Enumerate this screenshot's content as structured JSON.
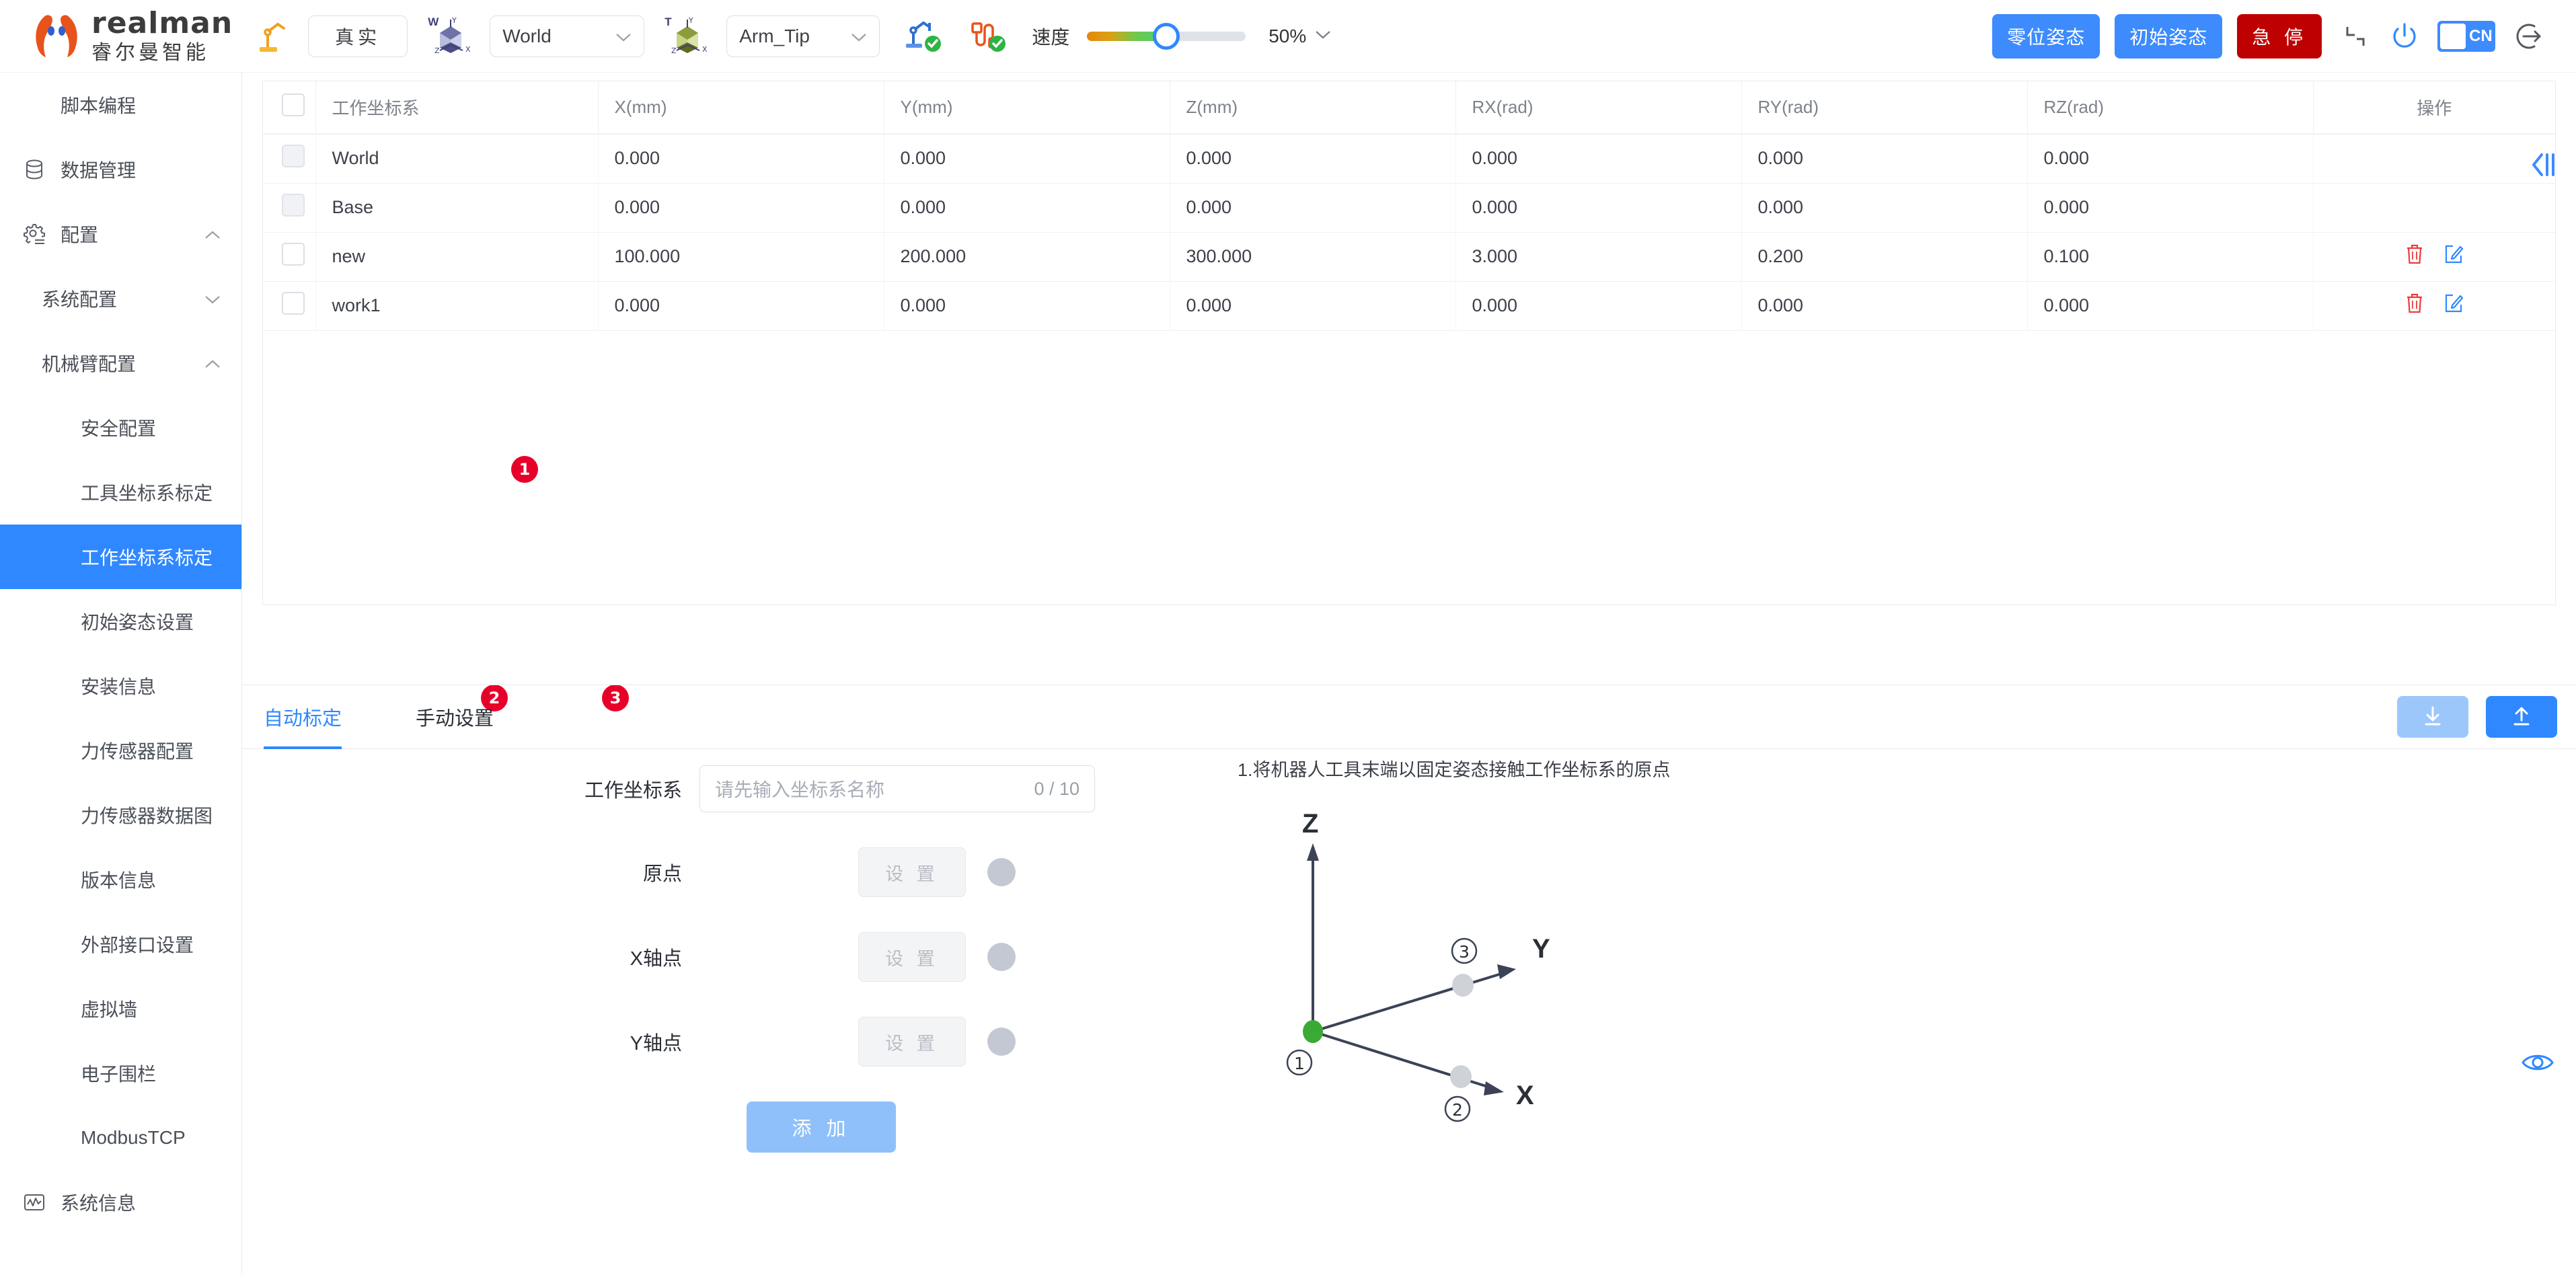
{
  "header": {
    "brand_en": "realman",
    "brand_cn": "睿尔曼智能",
    "robot_icon": "robot-arm-icon",
    "mode_select": {
      "value": "真实",
      "icon": "chevron-down-icon"
    },
    "world_frame_select": {
      "value": "World",
      "badge": "W",
      "icon": "chevron-down-icon"
    },
    "tool_frame_select": {
      "value": "Arm_Tip",
      "badge": "T",
      "icon": "chevron-down-icon"
    },
    "status_arm_icon": "robot-arm-connected-icon",
    "status_cable_icon": "cable-connected-icon",
    "speed_label": "速度",
    "speed_percent": 50,
    "zoom_value": "50%",
    "buttons": {
      "zero_pose": "零位姿态",
      "init_pose": "初始姿态",
      "emergency_stop": "急 停"
    },
    "icons": {
      "minimize": "minimize-icon",
      "power": "power-icon",
      "language": "CN",
      "logout": "logout-icon"
    },
    "colors": {
      "accent": "#3d8bfd",
      "danger": "#bf0000",
      "brand": "#e8531a"
    }
  },
  "sidebar": {
    "items": [
      {
        "label": "脚本编程",
        "icon": "code-icon",
        "level": 0,
        "arrow": "",
        "active": false
      },
      {
        "label": "数据管理",
        "icon": "database-icon",
        "level": 0,
        "arrow": "",
        "active": false
      },
      {
        "label": "配置",
        "icon": "gear-icon",
        "level": 0,
        "arrow": "chevron-up-icon",
        "active": false
      },
      {
        "label": "系统配置",
        "icon": "",
        "level": 1,
        "arrow": "chevron-down-icon",
        "active": false
      },
      {
        "label": "机械臂配置",
        "icon": "",
        "level": 1,
        "arrow": "chevron-up-icon",
        "active": false
      },
      {
        "label": "安全配置",
        "icon": "",
        "level": 2,
        "arrow": "",
        "active": false
      },
      {
        "label": "工具坐标系标定",
        "icon": "",
        "level": 2,
        "arrow": "",
        "active": false
      },
      {
        "label": "工作坐标系标定",
        "icon": "",
        "level": 2,
        "arrow": "",
        "active": true
      },
      {
        "label": "初始姿态设置",
        "icon": "",
        "level": 2,
        "arrow": "",
        "active": false
      },
      {
        "label": "安装信息",
        "icon": "",
        "level": 2,
        "arrow": "",
        "active": false
      },
      {
        "label": "力传感器配置",
        "icon": "",
        "level": 2,
        "arrow": "",
        "active": false
      },
      {
        "label": "力传感器数据图",
        "icon": "",
        "level": 2,
        "arrow": "",
        "active": false
      },
      {
        "label": "版本信息",
        "icon": "",
        "level": 2,
        "arrow": "",
        "active": false
      },
      {
        "label": "外部接口设置",
        "icon": "",
        "level": 2,
        "arrow": "",
        "active": false
      },
      {
        "label": "虚拟墙",
        "icon": "",
        "level": 2,
        "arrow": "",
        "active": false
      },
      {
        "label": "电子围栏",
        "icon": "",
        "level": 2,
        "arrow": "",
        "active": false
      },
      {
        "label": "ModbusTCP",
        "icon": "",
        "level": 2,
        "arrow": "",
        "active": false
      },
      {
        "label": "系统信息",
        "icon": "chart-icon",
        "level": 0,
        "arrow": "",
        "active": false
      }
    ]
  },
  "table": {
    "columns": [
      "工作坐标系",
      "X(mm)",
      "Y(mm)",
      "Z(mm)",
      "RX(rad)",
      "RY(rad)",
      "RZ(rad)",
      "操作"
    ],
    "rows": [
      {
        "name": "World",
        "x": "0.000",
        "y": "0.000",
        "z": "0.000",
        "rx": "0.000",
        "ry": "0.000",
        "rz": "0.000",
        "actions": false,
        "checkbox_disabled": true
      },
      {
        "name": "Base",
        "x": "0.000",
        "y": "0.000",
        "z": "0.000",
        "rx": "0.000",
        "ry": "0.000",
        "rz": "0.000",
        "actions": false,
        "checkbox_disabled": true
      },
      {
        "name": "new",
        "x": "100.000",
        "y": "200.000",
        "z": "300.000",
        "rx": "3.000",
        "ry": "0.200",
        "rz": "0.100",
        "actions": true,
        "checkbox_disabled": false
      },
      {
        "name": "work1",
        "x": "0.000",
        "y": "0.000",
        "z": "0.000",
        "rx": "0.000",
        "ry": "0.000",
        "rz": "0.000",
        "actions": true,
        "checkbox_disabled": false
      }
    ],
    "row_action_icons": {
      "delete": "trash-icon",
      "edit": "edit-icon"
    },
    "collapse_icon": "collapse-panel-icon"
  },
  "annotations": {
    "badge1": "1",
    "badge2": "2",
    "badge3": "3"
  },
  "tabs": [
    {
      "label": "自动标定",
      "active": true
    },
    {
      "label": "手动设置",
      "active": false
    }
  ],
  "tab_actions": {
    "download_icon": "download-icon",
    "upload_icon": "upload-icon"
  },
  "form": {
    "frame_name": {
      "label": "工作坐标系",
      "placeholder": "请先输入坐标系名称",
      "value": "",
      "counter": "0 / 10"
    },
    "points": [
      {
        "label": "原点",
        "button": "设 置",
        "status": "pending"
      },
      {
        "label": "X轴点",
        "button": "设 置",
        "status": "pending"
      },
      {
        "label": "Y轴点",
        "button": "设 置",
        "status": "pending"
      }
    ],
    "add_button": "添 加"
  },
  "diagram": {
    "title": "1.将机器人工具末端以固定姿态接触工作坐标系的原点",
    "axes": {
      "z": "Z",
      "y": "Y",
      "x": "X"
    },
    "point_labels": {
      "origin": "①",
      "x_point": "②",
      "y_point": "③"
    },
    "origin_color": "#3aaa35",
    "point_color": "#cfd2d8"
  },
  "eye_icon": "eye-icon"
}
